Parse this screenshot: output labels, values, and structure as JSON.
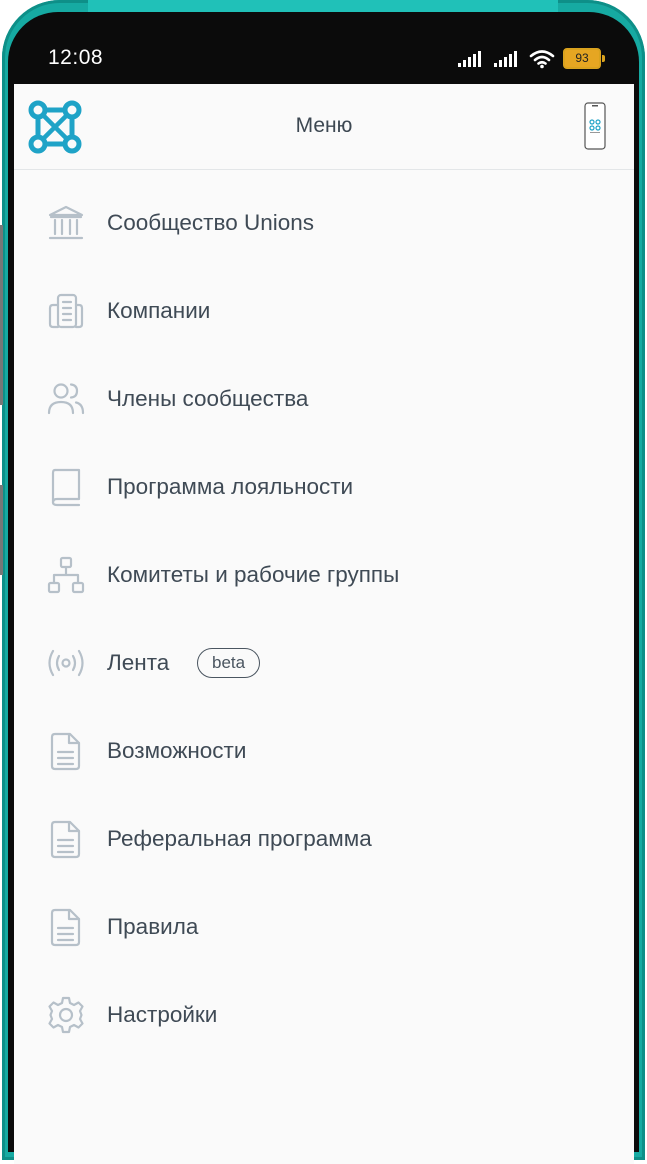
{
  "status_bar": {
    "time": "12:08",
    "battery": "93"
  },
  "header": {
    "title": "Меню"
  },
  "menu": {
    "items": [
      {
        "label": "Сообщество Unions",
        "icon": "bank-icon"
      },
      {
        "label": "Компании",
        "icon": "building-icon"
      },
      {
        "label": "Члены сообщества",
        "icon": "users-icon"
      },
      {
        "label": "Программа лояльности",
        "icon": "book-icon"
      },
      {
        "label": "Комитеты и рабочие группы",
        "icon": "hierarchy-icon"
      },
      {
        "label": "Лента",
        "icon": "broadcast-icon",
        "badge": "beta"
      },
      {
        "label": "Возможности",
        "icon": "document-icon"
      },
      {
        "label": "Реферальная программа",
        "icon": "document-icon"
      },
      {
        "label": "Правила",
        "icon": "document-icon"
      },
      {
        "label": "Настройки",
        "icon": "gear-icon"
      }
    ]
  },
  "colors": {
    "frame": "#16aaa2",
    "icon": "#b6c0c9",
    "text": "#3f4a55",
    "logo": "#1fa3c7"
  }
}
